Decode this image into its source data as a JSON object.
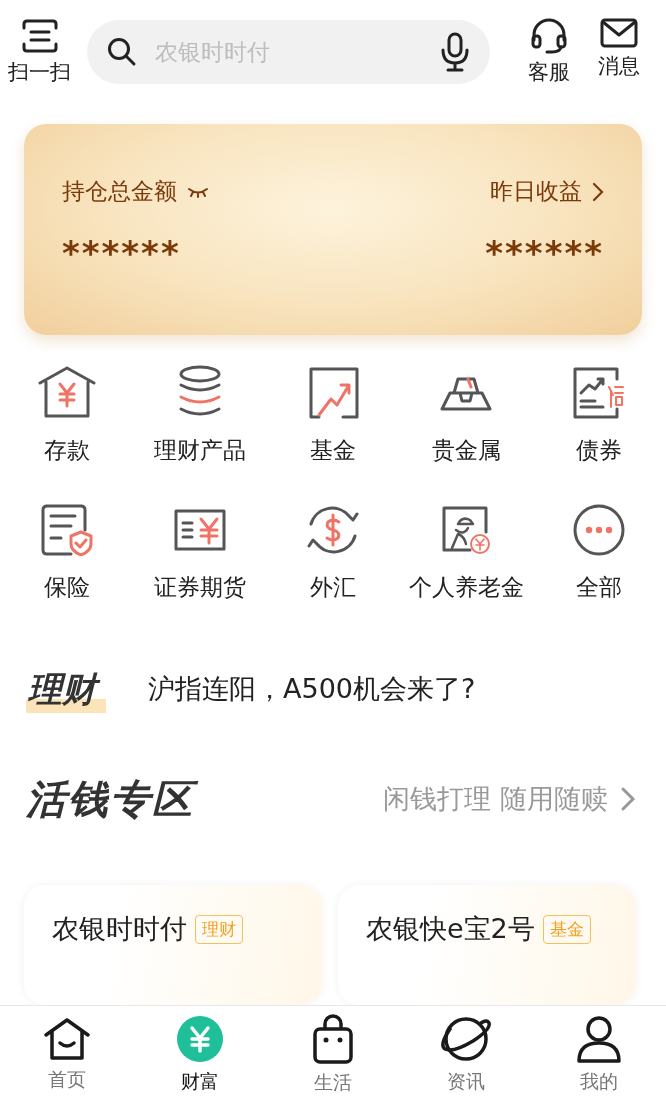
{
  "top_bar": {
    "scan": {
      "label": "扫一扫"
    },
    "search": {
      "placeholder": "农银时时付"
    },
    "actions": [
      {
        "kind": "service",
        "label": "客服"
      },
      {
        "kind": "message",
        "label": "消息"
      }
    ]
  },
  "assets_card": {
    "total_label": "持仓总金额",
    "total_value": "******",
    "yesterday_label": "昨日收益",
    "yesterday_value": "******"
  },
  "shortcuts": [
    {
      "kind": "deposit",
      "label": "存款"
    },
    {
      "kind": "wealth",
      "label": "理财产品"
    },
    {
      "kind": "fund",
      "label": "基金"
    },
    {
      "kind": "metal",
      "label": "贵金属"
    },
    {
      "kind": "bond",
      "label": "债券"
    },
    {
      "kind": "insurance",
      "label": "保险"
    },
    {
      "kind": "securities",
      "label": "证券期货"
    },
    {
      "kind": "forex",
      "label": "外汇"
    },
    {
      "kind": "pension",
      "label": "个人养老金"
    },
    {
      "kind": "all",
      "label": "全部"
    }
  ],
  "news": {
    "logo": "理财",
    "headline": "沪指连阳，A500机会来了?"
  },
  "section": {
    "title": "活钱专区",
    "subtitle": "闲钱打理 随用随赎"
  },
  "products": [
    {
      "name": "农银时时付",
      "tag": "理财"
    },
    {
      "name": "农银快e宝2号",
      "tag": "基金"
    }
  ],
  "tab_bar": [
    {
      "kind": "home",
      "label": "首页",
      "selected": false
    },
    {
      "kind": "wealth",
      "label": "财富",
      "selected": true
    },
    {
      "kind": "life",
      "label": "生活",
      "selected": false
    },
    {
      "kind": "news",
      "label": "资讯",
      "selected": false
    },
    {
      "kind": "me",
      "label": "我的",
      "selected": false
    }
  ]
}
